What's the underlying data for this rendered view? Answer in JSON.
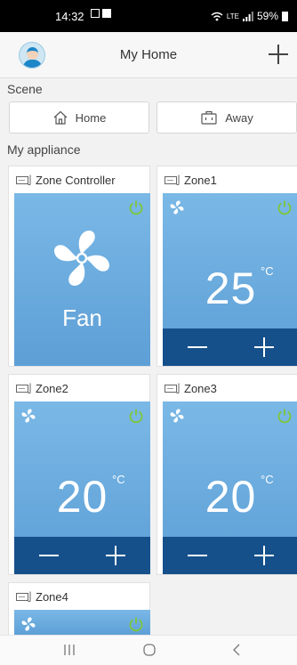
{
  "status_bar": {
    "time": "14:32",
    "network": "LTE",
    "battery": "59%"
  },
  "header": {
    "title": "My Home",
    "avatar_icon": "user-avatar-icon",
    "add_icon": "plus-icon"
  },
  "scene": {
    "label": "Scene",
    "buttons": [
      {
        "label": "Home",
        "icon": "home-icon"
      },
      {
        "label": "Away",
        "icon": "briefcase-icon"
      }
    ]
  },
  "appliances": {
    "label": "My appliance",
    "items": [
      {
        "name": "Zone Controller",
        "mode": "Fan",
        "power_on": true
      },
      {
        "name": "Zone1",
        "temperature": "25",
        "unit": "°C",
        "power_on": true
      },
      {
        "name": "Zone2",
        "temperature": "20",
        "unit": "°C",
        "power_on": true
      },
      {
        "name": "Zone3",
        "temperature": "20",
        "unit": "°C",
        "power_on": true
      },
      {
        "name": "Zone4",
        "power_on": true
      }
    ]
  },
  "colors": {
    "panel": "#6aaee0",
    "control_bar": "#15508b",
    "power_on": "#7ec63b"
  },
  "nav": {
    "recent_icon": "recent-apps-icon",
    "home_icon": "home-circle-icon",
    "back_icon": "back-chevron-icon"
  }
}
